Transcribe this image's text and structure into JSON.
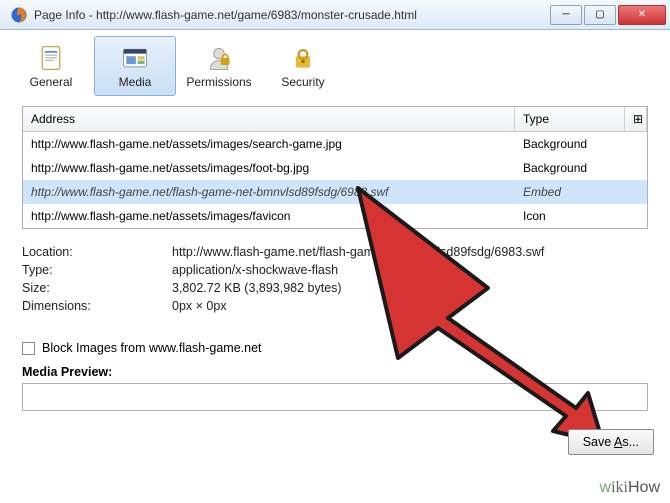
{
  "window": {
    "title": "Page Info - http://www.flash-game.net/game/6983/monster-crusade.html"
  },
  "tabs": {
    "general": "General",
    "media": "Media",
    "permissions": "Permissions",
    "security": "Security"
  },
  "list": {
    "hdr_address": "Address",
    "hdr_type": "Type",
    "rows": [
      {
        "addr": "http://www.flash-game.net/assets/images/search-game.jpg",
        "type": "Background"
      },
      {
        "addr": "http://www.flash-game.net/assets/images/foot-bg.jpg",
        "type": "Background"
      },
      {
        "addr": "http://www.flash-game.net/flash-game-net-bmnvlsd89fsdg/6983.swf",
        "type": "Embed"
      },
      {
        "addr": "http://www.flash-game.net/assets/images/favicon",
        "type": "Icon"
      }
    ]
  },
  "details": {
    "location_label": "Location:",
    "location_value": "http://www.flash-game.net/flash-game-net-bmnvlsd89fsdg/6983.swf",
    "type_label": "Type:",
    "type_value": "application/x-shockwave-flash",
    "size_label": "Size:",
    "size_value": "3,802.72 KB (3,893,982 bytes)",
    "dimensions_label": "Dimensions:",
    "dimensions_value": "0px × 0px"
  },
  "block_label": "Block Images from www.flash-game.net",
  "preview_label": "Media Preview:",
  "save_prefix": "Save ",
  "save_key": "A",
  "save_suffix": "s...",
  "watermark": "wikiHow"
}
